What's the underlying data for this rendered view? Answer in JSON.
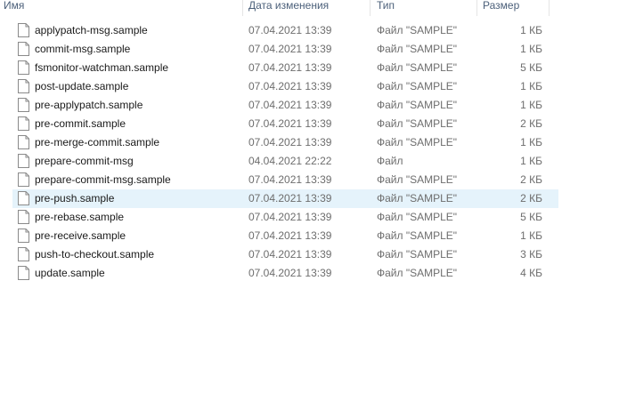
{
  "columns": {
    "name": "Имя",
    "date": "Дата изменения",
    "type": "Тип",
    "size": "Размер"
  },
  "hovered_row": 9,
  "files": [
    {
      "name": "applypatch-msg.sample",
      "date": "07.04.2021 13:39",
      "type": "Файл \"SAMPLE\"",
      "size": "1 КБ"
    },
    {
      "name": "commit-msg.sample",
      "date": "07.04.2021 13:39",
      "type": "Файл \"SAMPLE\"",
      "size": "1 КБ"
    },
    {
      "name": "fsmonitor-watchman.sample",
      "date": "07.04.2021 13:39",
      "type": "Файл \"SAMPLE\"",
      "size": "5 КБ"
    },
    {
      "name": "post-update.sample",
      "date": "07.04.2021 13:39",
      "type": "Файл \"SAMPLE\"",
      "size": "1 КБ"
    },
    {
      "name": "pre-applypatch.sample",
      "date": "07.04.2021 13:39",
      "type": "Файл \"SAMPLE\"",
      "size": "1 КБ"
    },
    {
      "name": "pre-commit.sample",
      "date": "07.04.2021 13:39",
      "type": "Файл \"SAMPLE\"",
      "size": "2 КБ"
    },
    {
      "name": "pre-merge-commit.sample",
      "date": "07.04.2021 13:39",
      "type": "Файл \"SAMPLE\"",
      "size": "1 КБ"
    },
    {
      "name": "prepare-commit-msg",
      "date": "04.04.2021 22:22",
      "type": "Файл",
      "size": "1 КБ"
    },
    {
      "name": "prepare-commit-msg.sample",
      "date": "07.04.2021 13:39",
      "type": "Файл \"SAMPLE\"",
      "size": "2 КБ"
    },
    {
      "name": "pre-push.sample",
      "date": "07.04.2021 13:39",
      "type": "Файл \"SAMPLE\"",
      "size": "2 КБ"
    },
    {
      "name": "pre-rebase.sample",
      "date": "07.04.2021 13:39",
      "type": "Файл \"SAMPLE\"",
      "size": "5 КБ"
    },
    {
      "name": "pre-receive.sample",
      "date": "07.04.2021 13:39",
      "type": "Файл \"SAMPLE\"",
      "size": "1 КБ"
    },
    {
      "name": "push-to-checkout.sample",
      "date": "07.04.2021 13:39",
      "type": "Файл \"SAMPLE\"",
      "size": "3 КБ"
    },
    {
      "name": "update.sample",
      "date": "07.04.2021 13:39",
      "type": "Файл \"SAMPLE\"",
      "size": "4 КБ"
    }
  ]
}
